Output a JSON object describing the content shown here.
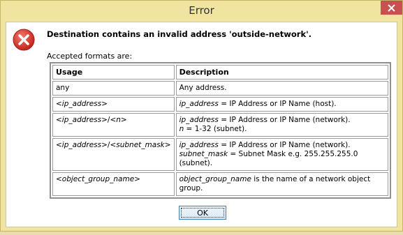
{
  "window": {
    "title": "Error"
  },
  "message": {
    "text": "Destination contains an invalid address 'outside-network'.",
    "icon": "error-icon",
    "accepted_label": "Accepted formats are:"
  },
  "table": {
    "headers": [
      "Usage",
      "Description"
    ],
    "rows": [
      {
        "usage": "any",
        "desc_line1_plain": "Any address."
      },
      {
        "usage": "<ip_address>",
        "desc_line1_term": "ip_address",
        "desc_line1_rest": " = IP Address or IP Name (host)."
      },
      {
        "usage_term1": "<ip_address>",
        "usage_sep": "/",
        "usage_term2": "<n>",
        "desc_line1_term": "ip_address",
        "desc_line1_rest": " = IP Address or IP Name (network).",
        "desc_line2_term": "n",
        "desc_line2_rest": " = 1-32 (subnet)."
      },
      {
        "usage_term1": "<ip_address>",
        "usage_sep": "/",
        "usage_term2": "<subnet_mask>",
        "desc_line1_term": "ip_address",
        "desc_line1_rest": " = IP Address or IP Name (network).",
        "desc_line2_term": "subnet_mask",
        "desc_line2_rest": " = Subnet Mask e.g. 255.255.255.0 (subnet)."
      },
      {
        "usage": "<object_group_name>",
        "desc_line1_term": "object_group_name",
        "desc_line1_rest": " is the name of a network object group."
      }
    ]
  },
  "buttons": {
    "ok_label": "OK"
  },
  "colors": {
    "title_bar": "#f1e4a0",
    "close_button": "#c75050",
    "error_icon": "#d9342b"
  }
}
